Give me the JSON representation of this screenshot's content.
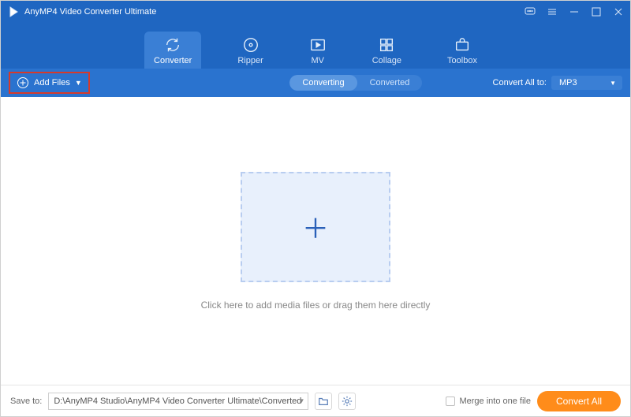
{
  "title": "AnyMP4 Video Converter Ultimate",
  "tabs": {
    "converter": "Converter",
    "ripper": "Ripper",
    "mv": "MV",
    "collage": "Collage",
    "toolbox": "Toolbox"
  },
  "subbar": {
    "add_files": "Add Files",
    "converting": "Converting",
    "converted": "Converted",
    "convert_all_to_label": "Convert All to:",
    "convert_all_to_value": "MP3"
  },
  "main": {
    "drop_hint": "Click here to add media files or drag them here directly"
  },
  "footer": {
    "save_to_label": "Save to:",
    "save_path": "D:\\AnyMP4 Studio\\AnyMP4 Video Converter Ultimate\\Converted",
    "merge_label": "Merge into one file",
    "convert_all": "Convert All"
  }
}
